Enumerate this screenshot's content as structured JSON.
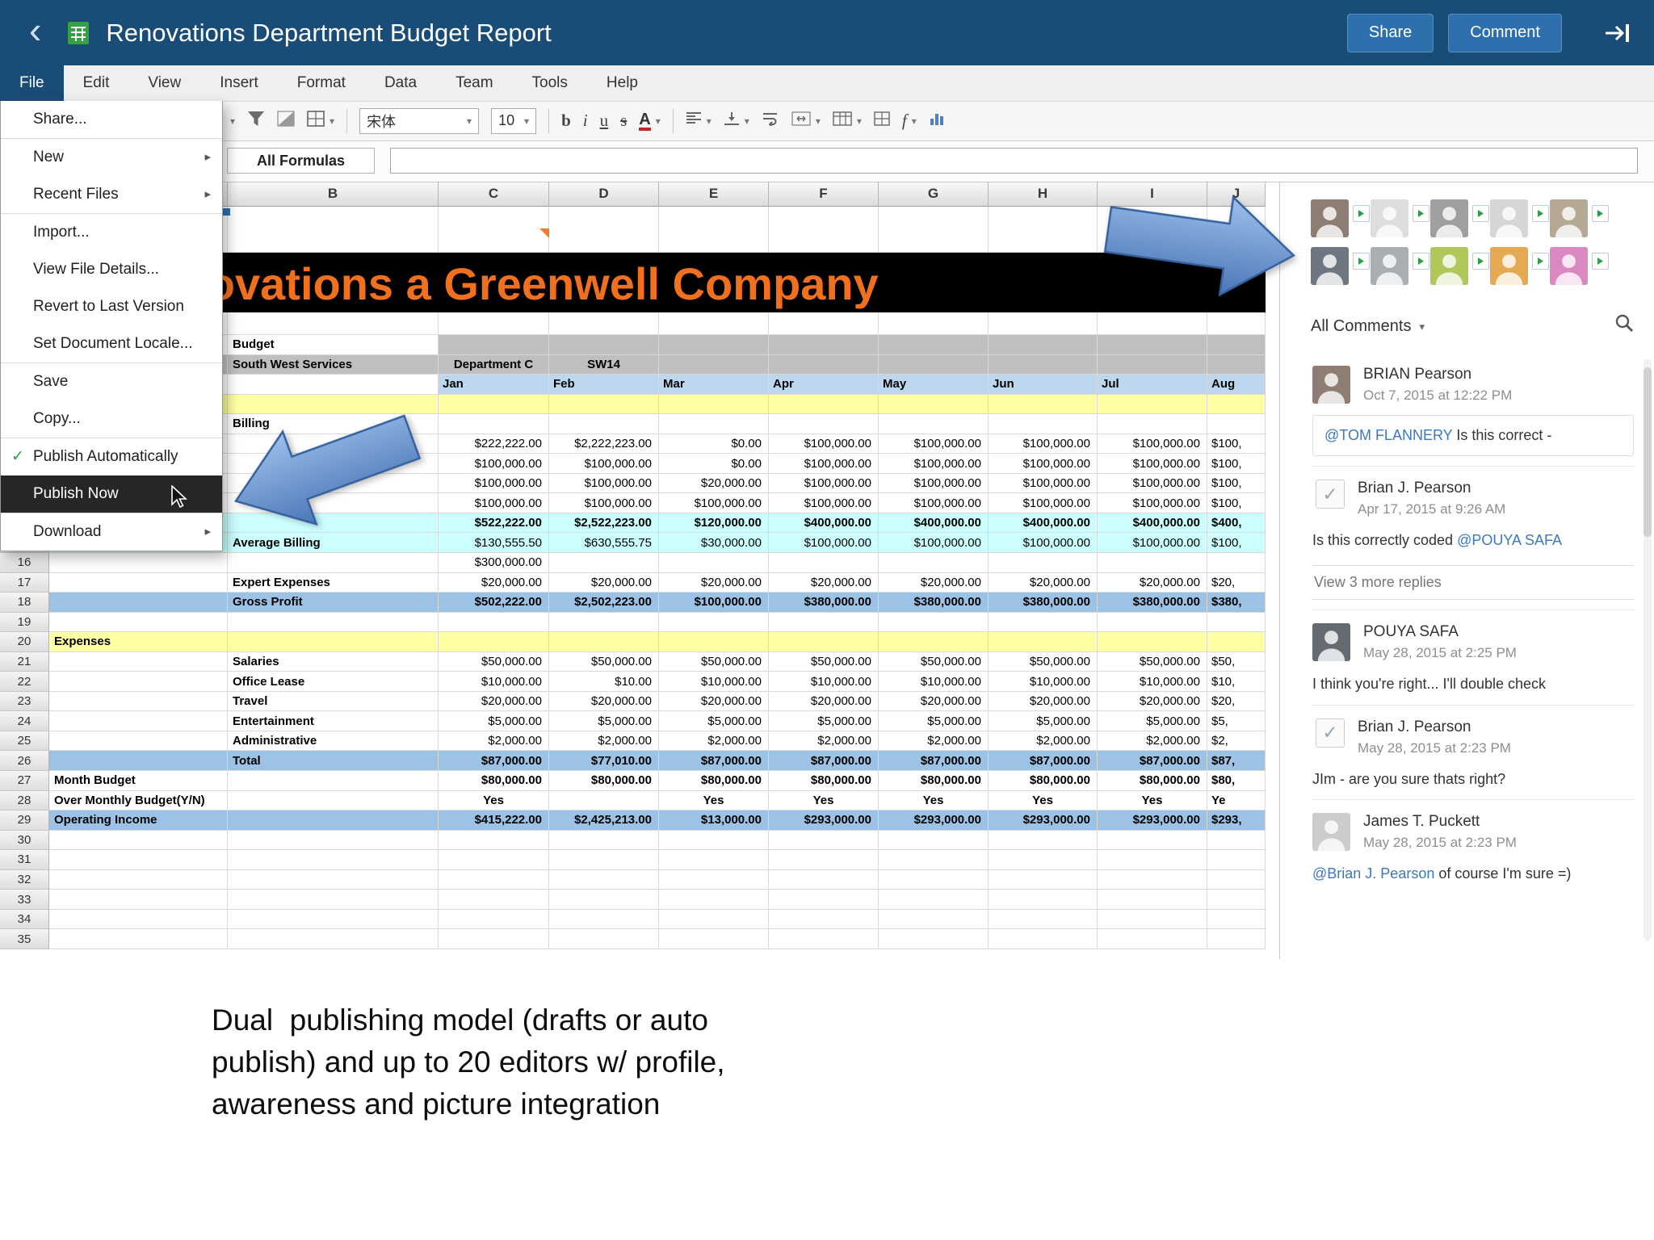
{
  "header": {
    "title": "Renovations Department Budget Report",
    "share_label": "Share",
    "comment_label": "Comment"
  },
  "menubar": {
    "items": [
      "File",
      "Edit",
      "View",
      "Insert",
      "Format",
      "Data",
      "Team",
      "Tools",
      "Help"
    ],
    "active": "File"
  },
  "file_menu": {
    "items": [
      {
        "label": "Share..."
      },
      {
        "label": "New",
        "submenu": true,
        "sep_above": true
      },
      {
        "label": "Recent Files",
        "submenu": true
      },
      {
        "label": "Import...",
        "sep_above": true
      },
      {
        "label": "View File Details..."
      },
      {
        "label": "Revert to Last Version"
      },
      {
        "label": "Set Document Locale..."
      },
      {
        "label": "Save",
        "sep_above": true
      },
      {
        "label": "Copy..."
      },
      {
        "label": "Publish Automatically",
        "checked": true,
        "sep_above": true
      },
      {
        "label": "Publish Now",
        "highlighted": true
      },
      {
        "label": "Download",
        "submenu": true,
        "sep_above": true
      }
    ]
  },
  "toolbar": {
    "font_name": "宋体",
    "font_size": "10",
    "bold_label": "b",
    "italic_label": "i",
    "underline_label": "u",
    "strike_label": "s",
    "fontcolor_label": "A",
    "function_label": "f"
  },
  "formula_bar": {
    "label": "All Formulas"
  },
  "sheet": {
    "banner_text": "Renovations a Greenwell Company",
    "columns": [
      "B",
      "C",
      "D",
      "E",
      "F",
      "G",
      "H",
      "I",
      "J"
    ],
    "rows": [
      {
        "num": "",
        "b": "Budget",
        "bg": "graydata",
        "cells": [
          "",
          "",
          "",
          "",
          "",
          "",
          "",
          ""
        ]
      },
      {
        "num": "",
        "b": "South West Services",
        "bg": "grayall",
        "cellbold": true,
        "cellalign": "center",
        "cells": [
          "Department C",
          "SW14",
          "",
          "",
          "",
          "",
          "",
          ""
        ]
      },
      {
        "num": "",
        "bg": "months",
        "cellbold": true,
        "cellalign": "left",
        "cells": [
          "Jan",
          "Feb",
          "Mar",
          "Apr",
          "May",
          "Jun",
          "Jul",
          "Aug"
        ]
      },
      {
        "num": "",
        "bg": "yellow",
        "cells": [
          "",
          "",
          "",
          "",
          "",
          "",
          "",
          ""
        ]
      },
      {
        "num": "",
        "b": "Billing",
        "cells": [
          "",
          "",
          "",
          "",
          "",
          "",
          "",
          ""
        ]
      },
      {
        "num": "",
        "cells": [
          "$222,222.00",
          "$2,222,223.00",
          "$0.00",
          "$100,000.00",
          "$100,000.00",
          "$100,000.00",
          "$100,000.00",
          "$100,"
        ]
      },
      {
        "num": "",
        "cells": [
          "$100,000.00",
          "$100,000.00",
          "$0.00",
          "$100,000.00",
          "$100,000.00",
          "$100,000.00",
          "$100,000.00",
          "$100,"
        ]
      },
      {
        "num": "",
        "cells": [
          "$100,000.00",
          "$100,000.00",
          "$20,000.00",
          "$100,000.00",
          "$100,000.00",
          "$100,000.00",
          "$100,000.00",
          "$100,"
        ]
      },
      {
        "num": "",
        "cells": [
          "$100,000.00",
          "$100,000.00",
          "$100,000.00",
          "$100,000.00",
          "$100,000.00",
          "$100,000.00",
          "$100,000.00",
          "$100,"
        ]
      },
      {
        "num": "",
        "b": "",
        "bg": "cyan",
        "cellbold": true,
        "cells": [
          "$522,222.00",
          "$2,522,223.00",
          "$120,000.00",
          "$400,000.00",
          "$400,000.00",
          "$400,000.00",
          "$400,000.00",
          "$400,"
        ]
      },
      {
        "num": "",
        "b": "Average Billing",
        "bg": "cyan",
        "cells": [
          "$130,555.50",
          "$630,555.75",
          "$30,000.00",
          "$100,000.00",
          "$100,000.00",
          "$100,000.00",
          "$100,000.00",
          "$100,"
        ]
      },
      {
        "num": "16",
        "cells": [
          "$300,000.00",
          "",
          "",
          "",
          "",
          "",
          "",
          ""
        ]
      },
      {
        "num": "17",
        "b": "Expert Expenses",
        "cells": [
          "$20,000.00",
          "$20,000.00",
          "$20,000.00",
          "$20,000.00",
          "$20,000.00",
          "$20,000.00",
          "$20,000.00",
          "$20,"
        ]
      },
      {
        "num": "18",
        "b": "Gross Profit",
        "bg": "blue",
        "cellbold": true,
        "cells": [
          "$502,222.00",
          "$2,502,223.00",
          "$100,000.00",
          "$380,000.00",
          "$380,000.00",
          "$380,000.00",
          "$380,000.00",
          "$380,"
        ]
      },
      {
        "num": "19",
        "cells": [
          "",
          "",
          "",
          "",
          "",
          "",
          "",
          ""
        ]
      },
      {
        "num": "20",
        "a": "Expenses",
        "bg": "yellow",
        "cells": [
          "",
          "",
          "",
          "",
          "",
          "",
          "",
          ""
        ]
      },
      {
        "num": "21",
        "b": "Salaries",
        "cells": [
          "$50,000.00",
          "$50,000.00",
          "$50,000.00",
          "$50,000.00",
          "$50,000.00",
          "$50,000.00",
          "$50,000.00",
          "$50,"
        ]
      },
      {
        "num": "22",
        "b": "Office Lease",
        "cells": [
          "$10,000.00",
          "$10.00",
          "$10,000.00",
          "$10,000.00",
          "$10,000.00",
          "$10,000.00",
          "$10,000.00",
          "$10,"
        ]
      },
      {
        "num": "23",
        "b": "Travel",
        "cells": [
          "$20,000.00",
          "$20,000.00",
          "$20,000.00",
          "$20,000.00",
          "$20,000.00",
          "$20,000.00",
          "$20,000.00",
          "$20,"
        ]
      },
      {
        "num": "24",
        "b": "Entertainment",
        "cells": [
          "$5,000.00",
          "$5,000.00",
          "$5,000.00",
          "$5,000.00",
          "$5,000.00",
          "$5,000.00",
          "$5,000.00",
          "$5,"
        ]
      },
      {
        "num": "25",
        "b": "Administrative",
        "cells": [
          "$2,000.00",
          "$2,000.00",
          "$2,000.00",
          "$2,000.00",
          "$2,000.00",
          "$2,000.00",
          "$2,000.00",
          "$2,"
        ]
      },
      {
        "num": "26",
        "b": "Total",
        "bg": "blue",
        "cellbold": true,
        "cells": [
          "$87,000.00",
          "$77,010.00",
          "$87,000.00",
          "$87,000.00",
          "$87,000.00",
          "$87,000.00",
          "$87,000.00",
          "$87,"
        ]
      },
      {
        "num": "27",
        "a": "Month Budget",
        "cellbold": true,
        "cells": [
          "$80,000.00",
          "$80,000.00",
          "$80,000.00",
          "$80,000.00",
          "$80,000.00",
          "$80,000.00",
          "$80,000.00",
          "$80,"
        ]
      },
      {
        "num": "28",
        "a": "Over Monthly Budget(Y/N)",
        "cellbold": true,
        "cellalign": "center",
        "cells": [
          "Yes",
          "",
          "Yes",
          "Yes",
          "Yes",
          "Yes",
          "Yes",
          "Ye"
        ]
      },
      {
        "num": "29",
        "a": "Operating Income",
        "bg": "blue",
        "cellbold": true,
        "cells": [
          "$415,222.00",
          "$2,425,213.00",
          "$13,000.00",
          "$293,000.00",
          "$293,000.00",
          "$293,000.00",
          "$293,000.00",
          "$293,"
        ]
      },
      {
        "num": "30",
        "cells": [
          "",
          "",
          "",
          "",
          "",
          "",
          "",
          ""
        ]
      },
      {
        "num": "31",
        "cells": [
          "",
          "",
          "",
          "",
          "",
          "",
          "",
          ""
        ]
      },
      {
        "num": "32",
        "cells": [
          "",
          "",
          "",
          "",
          "",
          "",
          "",
          ""
        ]
      },
      {
        "num": "33",
        "cells": [
          "",
          "",
          "",
          "",
          "",
          "",
          "",
          ""
        ]
      },
      {
        "num": "34",
        "cells": [
          "",
          "",
          "",
          "",
          "",
          "",
          "",
          ""
        ]
      },
      {
        "num": "35",
        "cells": [
          "",
          "",
          "",
          "",
          "",
          "",
          "",
          ""
        ]
      }
    ]
  },
  "panel": {
    "filter_label": "All Comments",
    "avatars": [
      {
        "color": "#7a675a"
      },
      {
        "color": "#d8d8d8"
      },
      {
        "color": "#8f8f8f"
      },
      {
        "color": "#cfcfcf"
      },
      {
        "color": "#a89a82"
      },
      {
        "color": "#55606c"
      },
      {
        "color": "#9aa0a6"
      },
      {
        "color": "#a3bf3c"
      },
      {
        "color": "#e29a36"
      },
      {
        "color": "#d674b6"
      }
    ],
    "comments": [
      {
        "name": "BRIAN Pearson",
        "date": "Oct 7, 2015 at 12:22 PM",
        "avatar_color": "#7a675a",
        "boxed": true,
        "body": [
          {
            "t": "@TOM FLANNERY",
            "link": true
          },
          {
            "t": " Is this correct -"
          }
        ]
      },
      {
        "name": "Brian J. Pearson",
        "date": "Apr 17, 2015 at 9:26 AM",
        "resolved": true,
        "body": [
          {
            "t": "Is this correctly coded "
          },
          {
            "t": "@POUYA SAFA",
            "link": true
          }
        ],
        "more": "View 3 more replies"
      },
      {
        "name": "POUYA SAFA",
        "date": "May 28, 2015 at 2:25 PM",
        "avatar_color": "#4a5259",
        "body": [
          {
            "t": "I think you're right... I'll double check"
          }
        ]
      },
      {
        "name": "Brian J. Pearson",
        "date": "May 28, 2015 at 2:23 PM",
        "resolved": true,
        "body": [
          {
            "t": "JIm - are you sure thats right?"
          }
        ]
      },
      {
        "name": "James T. Puckett",
        "date": "May 28, 2015 at 2:23 PM",
        "avatar_color": "#c4c4c4",
        "body": [
          {
            "t": "@Brian J. Pearson",
            "link": true
          },
          {
            "t": " of course I'm sure =)"
          }
        ]
      }
    ]
  },
  "caption": {
    "lines": [
      "Dual  publishing model (drafts or auto",
      "publish) and up to 20 editors w/ profile,",
      "awareness and picture integration"
    ]
  }
}
